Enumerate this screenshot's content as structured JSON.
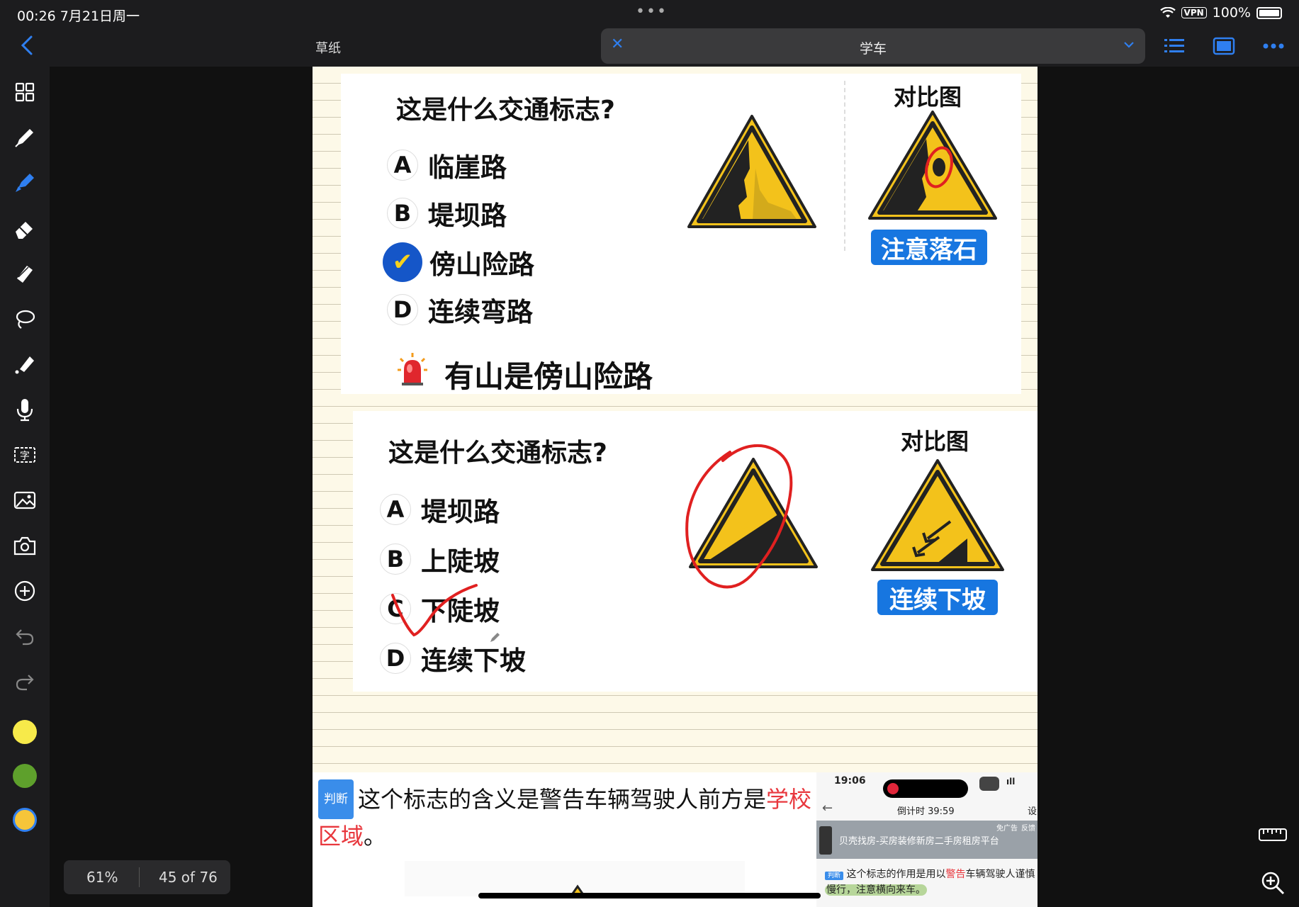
{
  "status": {
    "time_date": "00:26  7月21日周一",
    "dots": "•••",
    "vpn": "VPN",
    "battery": "100%"
  },
  "topbar": {
    "scratch_tab": "草纸",
    "active_tab": "学车"
  },
  "q1": {
    "question": "这是什么交通标志?",
    "options": [
      {
        "letter": "A",
        "text": "临崖路"
      },
      {
        "letter": "B",
        "text": "堤坝路"
      },
      {
        "letter": "✔",
        "text": "傍山险路"
      },
      {
        "letter": "D",
        "text": "连续弯路"
      }
    ],
    "compare_title": "对比图",
    "compare_label": "注意落石",
    "tip": "有山是傍山险路"
  },
  "q2": {
    "question": "这是什么交通标志?",
    "options": [
      {
        "letter": "A",
        "text": "堤坝路"
      },
      {
        "letter": "B",
        "text": "上陡坡"
      },
      {
        "letter": "C",
        "text": "下陡坡"
      },
      {
        "letter": "D",
        "text": "连续下坡"
      }
    ],
    "compare_title": "对比图",
    "compare_label": "连续下坡"
  },
  "q3": {
    "tag": "判断",
    "text_before": "这个标志的含义是警告车辆驾驶人前方是",
    "text_red": "学校区域",
    "text_after": "。"
  },
  "phone": {
    "time": "19:06",
    "countdown": "倒计时 39:59",
    "ad_text": "贝壳找房-买房装修新房二手房租房平台",
    "ad_badge1": "免广告",
    "ad_badge2": "反馈",
    "tag": "判断",
    "text_a": "这个标志的作用是用以",
    "text_red": "警告",
    "text_b": "车辆驾驶人谨慎",
    "text_c": "慢行，注意横向来车。",
    "cut": "设"
  },
  "footer": {
    "zoom": "61%",
    "page": "45 of 76"
  },
  "colors": {
    "accent": "#2f7ff0",
    "sign_yellow": "#f3c21b",
    "blue_box": "#1776e0",
    "pen_red": "#e02020"
  }
}
